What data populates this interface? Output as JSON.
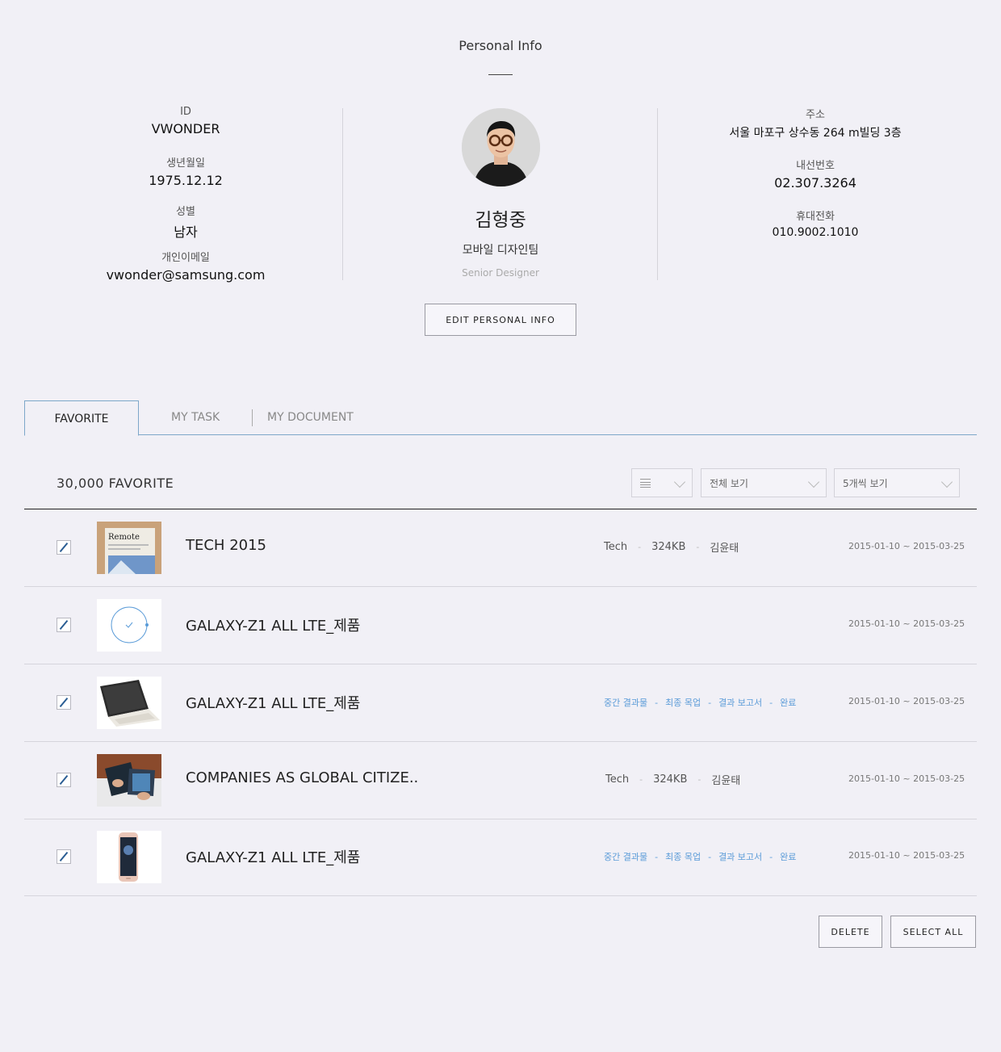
{
  "header": {
    "title": "Personal Info"
  },
  "profile": {
    "left_fields": [
      {
        "label": "ID",
        "value": "VWONDER"
      },
      {
        "label": "생년월일",
        "value": "1975.12.12"
      },
      {
        "label": "성별",
        "value": "남자"
      },
      {
        "label": "개인이메일",
        "value": "vwonder@samsung.com"
      }
    ],
    "name": "김형중",
    "department": "모바일 디자인팀",
    "position": "Senior Designer",
    "right_fields": [
      {
        "label": "주소",
        "value": "서울 마포구 상수동 264 m빌딩 3층"
      },
      {
        "label": "내선번호",
        "value": "02.307.3264"
      },
      {
        "label": "휴대전화",
        "value": "010.9002.1010"
      }
    ],
    "edit_button": "EDIT PERSONAL INFO"
  },
  "tabs": [
    {
      "label": "FAVORITE",
      "active": true
    },
    {
      "label": "MY TASK",
      "active": false
    },
    {
      "label": "MY DOCUMENT",
      "active": false
    }
  ],
  "list": {
    "count_label": "30,000 FAVORITE",
    "filters": {
      "view_icon": "list-view-icon",
      "scope": "전체 보기",
      "page_size": "5개씩 보기"
    },
    "rows": [
      {
        "title": "TECH 2015",
        "meta": [
          "Tech",
          "324KB",
          "김윤태"
        ],
        "status": [],
        "date": "2015-01-10 ~ 2015-03-25",
        "thumb": "book-cover"
      },
      {
        "title": "GALAXY-Z1 ALL LTE_제품",
        "meta": [],
        "status": [],
        "date": "2015-01-10 ~ 2015-03-25",
        "thumb": "loading-circle"
      },
      {
        "title": "GALAXY-Z1 ALL LTE_제품",
        "meta": [],
        "status": [
          "중간 결과물",
          "최종 목업",
          "결과 보고서",
          "완료"
        ],
        "date": "2015-01-10 ~ 2015-03-25",
        "thumb": "tablet-keyboard"
      },
      {
        "title": "COMPANIES AS GLOBAL CITIZE..",
        "meta": [
          "Tech",
          "324KB",
          "김윤태"
        ],
        "status": [],
        "date": "2015-01-10 ~ 2015-03-25",
        "thumb": "hands-tablet"
      },
      {
        "title": "GALAXY-Z1 ALL LTE_제품",
        "meta": [],
        "status": [
          "중간 결과물",
          "최종 목업",
          "결과 보고서",
          "완료"
        ],
        "date": "2015-01-10 ~ 2015-03-25",
        "thumb": "phone"
      }
    ],
    "thumb_text": "Remote"
  },
  "actions": {
    "delete": "DELETE",
    "select_all": "SELECT ALL"
  },
  "colors": {
    "background": "#f1f0f6",
    "accent": "#5a9bd8",
    "tab_border": "#7da7c9",
    "checkbox_mark": "#2a5d93"
  }
}
